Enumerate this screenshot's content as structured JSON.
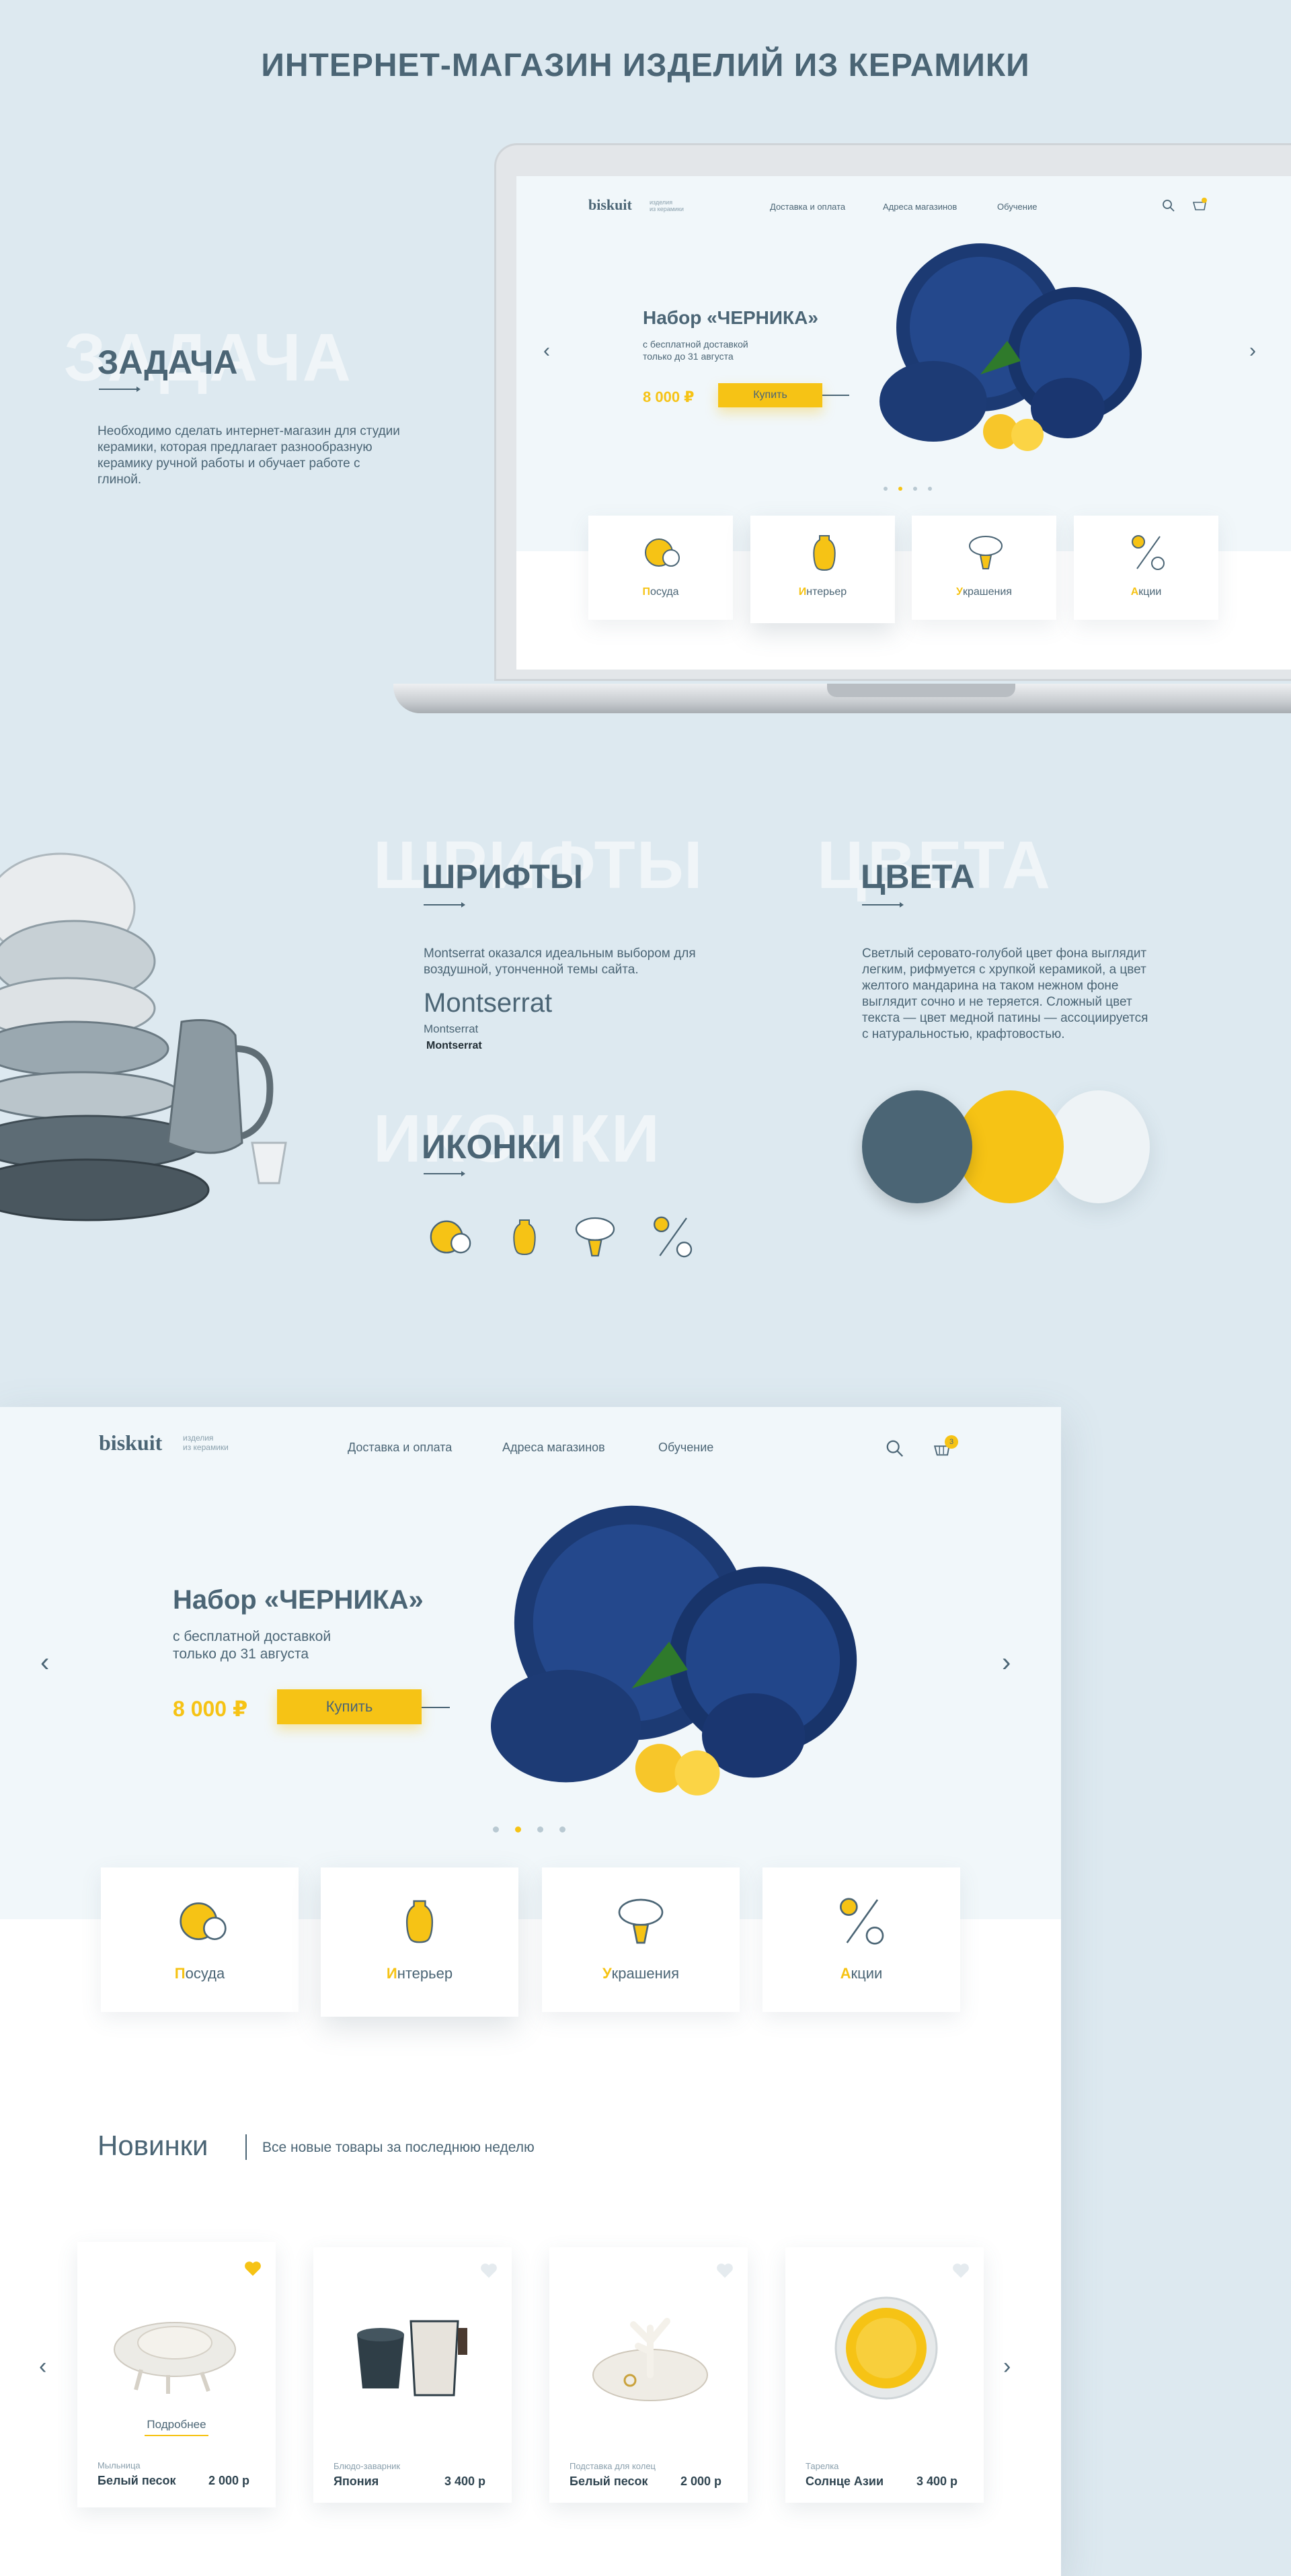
{
  "page_title": "ИНТЕРНЕТ-МАГАЗИН ИЗДЕЛИЙ ИЗ КЕРАМИКИ",
  "task": {
    "ghost": "ЗАДАЧА",
    "title": "ЗАДАЧА",
    "text": "Необходимо сделать интернет-магазин для студии керамики, которая предлагает разнообразную керамику ручной работы и обучает работе с глиной."
  },
  "fonts": {
    "ghost": "ШРИФТЫ",
    "title": "ШРИФТЫ",
    "text": "Montserrat оказался идеальным выбором для воздушной, утонченной темы сайта.",
    "sample_large": "Montserrat",
    "sample_regular": "Montserrat",
    "sample_bold": "Montserrat"
  },
  "colors": {
    "ghost": "ЦВЕТА",
    "title": "ЦВЕТА",
    "text": "Светлый серовато-голубой цвет фона выглядит легким, рифмуется с хрупкой керамикой, а цвет желтого мандарина на таком нежном фоне выглядит сочно и не теряется. Сложный цвет текста — цвет медной патины — ассоциируется с натуральностью, крафтовостью.",
    "swatches": [
      "#4b6575",
      "#f6c315",
      "#eef3f6"
    ]
  },
  "icons_section": {
    "ghost": "ИКОНКИ",
    "title": "ИКОНКИ",
    "items": [
      "dishes-icon",
      "vase-icon",
      "lamp-icon",
      "percent-icon"
    ]
  },
  "site": {
    "logo": "biskuit",
    "logo_sub_1": "изделия",
    "logo_sub_2": "из керамики",
    "nav": [
      "Доставка и оплата",
      "Адреса магазинов",
      "Обучение"
    ],
    "cart_count": "3",
    "hero": {
      "title": "Набор «ЧЕРНИКА»",
      "line1": "с бесплатной доставкой",
      "line2": "только до 31 августа",
      "price": "8 000 ₽",
      "buy": "Купить"
    },
    "categories": [
      {
        "first": "П",
        "rest": "осуда",
        "icon": "dishes-icon"
      },
      {
        "first": "И",
        "rest": "нтерьер",
        "icon": "vase-icon"
      },
      {
        "first": "У",
        "rest": "крашения",
        "icon": "lamp-icon"
      },
      {
        "first": "А",
        "rest": "кции",
        "icon": "percent-icon"
      }
    ],
    "new_title": "Новинки",
    "new_sub": "Все новые товары за последнюю неделю",
    "more": "Подробнее",
    "products": [
      {
        "type": "Мыльница",
        "name": "Белый песок",
        "price": "2 000 р",
        "liked": true
      },
      {
        "type": "Блюдо-заварник",
        "name": "Япония",
        "price": "3 400 р",
        "liked": false
      },
      {
        "type": "Подставка для колец",
        "name": "Белый песок",
        "price": "2 000 р",
        "liked": false
      },
      {
        "type": "Тарелка",
        "name": "Солнце Азии",
        "price": "3 400 р",
        "liked": false
      }
    ]
  }
}
